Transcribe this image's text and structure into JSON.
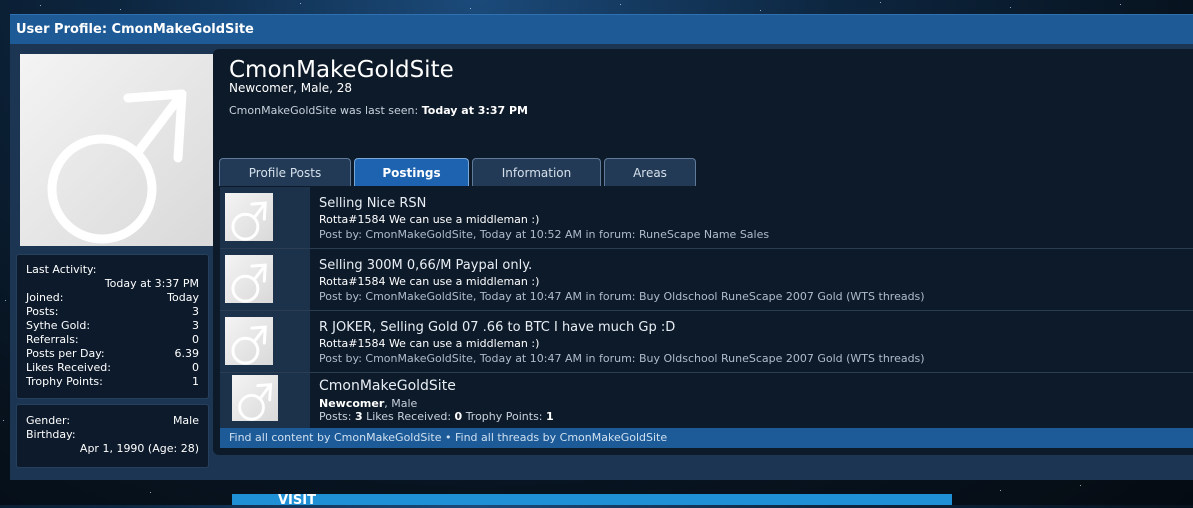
{
  "page": {
    "header_title": "User Profile: CmonMakeGoldSite"
  },
  "profile": {
    "username": "CmonMakeGoldSite",
    "subtitle": "Newcomer, Male, 28",
    "last_seen_label": "CmonMakeGoldSite was last seen:",
    "last_seen_value": "Today at 3:37 PM"
  },
  "sidebar": {
    "last_activity_label": "Last Activity:",
    "last_activity_value": "Today at 3:37 PM",
    "stats": [
      {
        "label": "Joined:",
        "value": "Today"
      },
      {
        "label": "Posts:",
        "value": "3"
      },
      {
        "label": "Sythe Gold:",
        "value": "3"
      },
      {
        "label": "Referrals:",
        "value": "0"
      },
      {
        "label": "Posts per Day:",
        "value": "6.39"
      },
      {
        "label": "Likes Received:",
        "value": "0"
      },
      {
        "label": "Trophy Points:",
        "value": "1"
      }
    ],
    "gender_label": "Gender:",
    "gender_value": "Male",
    "birthday_label": "Birthday:",
    "birthday_value": "Apr 1, 1990 (Age: 28)"
  },
  "tabs": [
    {
      "label": "Profile Posts"
    },
    {
      "label": "Postings"
    },
    {
      "label": "Information"
    },
    {
      "label": "Areas"
    }
  ],
  "active_tab": "Postings",
  "postings": [
    {
      "title": "Selling Nice RSN",
      "snippet": "Rotta#1584 We can use a middleman :)",
      "meta": "Post by: CmonMakeGoldSite, Today at 10:52 AM in forum: RuneScape Name Sales"
    },
    {
      "title": "Selling 300M 0,66/M Paypal only.",
      "snippet": "Rotta#1584 We can use a middleman :)",
      "meta": "Post by: CmonMakeGoldSite, Today at 10:47 AM in forum: Buy Oldschool RuneScape 2007 Gold (WTS threads)"
    },
    {
      "title": "R JOKER, Selling Gold 07 .66 to BTC I have much Gp :D",
      "snippet": "Rotta#1584 We can use a middleman :)",
      "meta": "Post by: CmonMakeGoldSite, Today at 10:47 AM in forum: Buy Oldschool RuneScape 2007 Gold (WTS threads)"
    }
  ],
  "member_row": {
    "name": "CmonMakeGoldSite",
    "rank": "Newcomer",
    "gender": ", Male",
    "posts_label": "Posts:",
    "posts_value": "3",
    "likes_label": "Likes Received:",
    "likes_value": "0",
    "trophy_label": "Trophy Points:",
    "trophy_value": "1"
  },
  "footer": {
    "find_content": "Find all content by CmonMakeGoldSite",
    "separator": "•",
    "find_threads": "Find all threads by CmonMakeGoldSite"
  },
  "bottom_banner": {
    "text": "VISIT"
  },
  "colors": {
    "header": "#1e5a96",
    "active_tab": "#1e63b0",
    "panel": "#1c3552",
    "content_bg": "#0d1a2a"
  }
}
